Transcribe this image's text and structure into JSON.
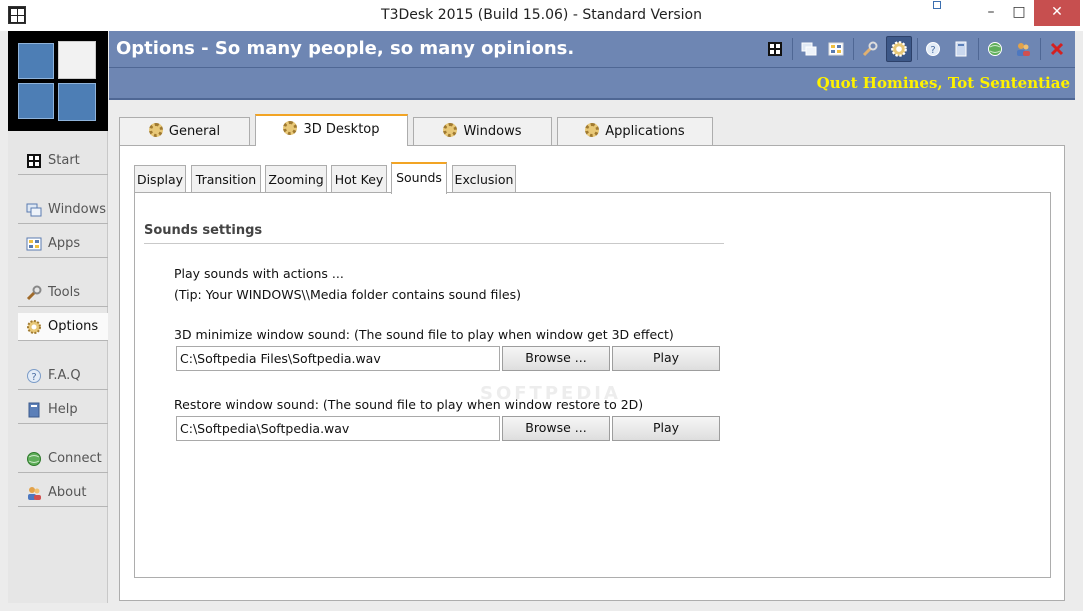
{
  "window": {
    "title": "T3Desk 2015 (Build 15.06) - Standard Version",
    "close_label": "✕",
    "maximize_label": "□",
    "minimize_label": "–"
  },
  "sidebar": {
    "items": [
      {
        "label": "Start",
        "icon": "start-icon"
      },
      {
        "label": "Windows",
        "icon": "windows-icon"
      },
      {
        "label": "Apps",
        "icon": "apps-icon"
      },
      {
        "label": "Tools",
        "icon": "wrench-icon"
      },
      {
        "label": "Options",
        "icon": "gear-icon",
        "active": true
      },
      {
        "label": "F.A.Q",
        "icon": "faq-icon"
      },
      {
        "label": "Help",
        "icon": "help-book-icon"
      },
      {
        "label": "Connect",
        "icon": "globe-icon"
      },
      {
        "label": "About",
        "icon": "people-icon"
      }
    ]
  },
  "header": {
    "title": "Options - So many people, so many opinions.",
    "motto": "Quot Homines, Tot Sententiae"
  },
  "main_tabs": [
    {
      "label": "General"
    },
    {
      "label": "3D Desktop",
      "active": true
    },
    {
      "label": "Windows"
    },
    {
      "label": "Applications"
    }
  ],
  "sub_tabs": [
    {
      "label": "Display"
    },
    {
      "label": "Transition"
    },
    {
      "label": "Zooming"
    },
    {
      "label": "Hot Key"
    },
    {
      "label": "Sounds",
      "active": true
    },
    {
      "label": "Exclusion"
    }
  ],
  "sounds": {
    "section_title": "Sounds settings",
    "intro": "Play sounds with actions ...",
    "tip": "(Tip: Your WINDOWS\\\\Media folder contains sound files)",
    "minimize_label": "3D minimize window sound: (The sound file to play when window get 3D effect)",
    "minimize_value": "C:\\Softpedia Files\\Softpedia.wav",
    "restore_label": "Restore window sound: (The sound file to play when window restore to 2D)",
    "restore_value": "C:\\Softpedia\\Softpedia.wav",
    "browse_label": "Browse ...",
    "play_label": "Play"
  },
  "colors": {
    "header_bg": "#6e86b3",
    "motto_color": "#fff200",
    "active_tab_accent": "#f2a424",
    "close_btn": "#c74f4f"
  }
}
